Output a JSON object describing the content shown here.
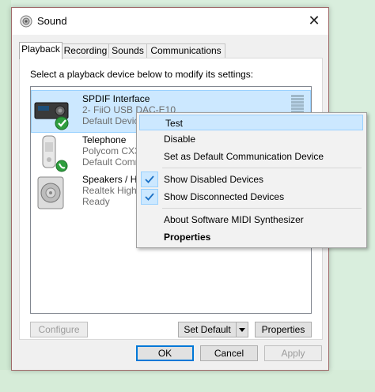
{
  "window": {
    "title": "Sound",
    "close_glyph": "✕",
    "icon": "speaker-icon"
  },
  "tabs": [
    {
      "label": "Playback",
      "active": true
    },
    {
      "label": "Recording",
      "active": false
    },
    {
      "label": "Sounds",
      "active": false
    },
    {
      "label": "Communications",
      "active": false
    }
  ],
  "instruction": "Select a playback device below to modify its settings:",
  "devices": [
    {
      "name": "SPDIF Interface",
      "sub": "2- FiiO USB DAC-E10",
      "status": "Default Devic",
      "icon": "dac-icon",
      "badge": "default-check",
      "selected": true
    },
    {
      "name": "Telephone",
      "sub": "Polycom CX30",
      "status": "Default Comm",
      "icon": "telephone-icon",
      "badge": "phone-badge"
    },
    {
      "name": "Speakers / He",
      "sub": "Realtek High",
      "status": "Ready",
      "icon": "speaker-icon"
    }
  ],
  "buttons": {
    "configure": "Configure",
    "set_default": "Set Default",
    "properties": "Properties",
    "ok": "OK",
    "cancel": "Cancel",
    "apply": "Apply"
  },
  "context_menu": {
    "items": [
      {
        "label": "Test",
        "highlighted": true
      },
      {
        "label": "Disable"
      },
      {
        "label": "Set as Default Communication Device"
      },
      {
        "label": "Show Disabled Devices",
        "checked": true
      },
      {
        "label": "Show Disconnected Devices",
        "checked": true
      },
      {
        "label": "About Software MIDI Synthesizer"
      },
      {
        "label": "Properties",
        "bold": true
      }
    ]
  },
  "colors": {
    "selection": "#cce8ff",
    "accent": "#0078d7",
    "check": "#1a6fc4"
  }
}
